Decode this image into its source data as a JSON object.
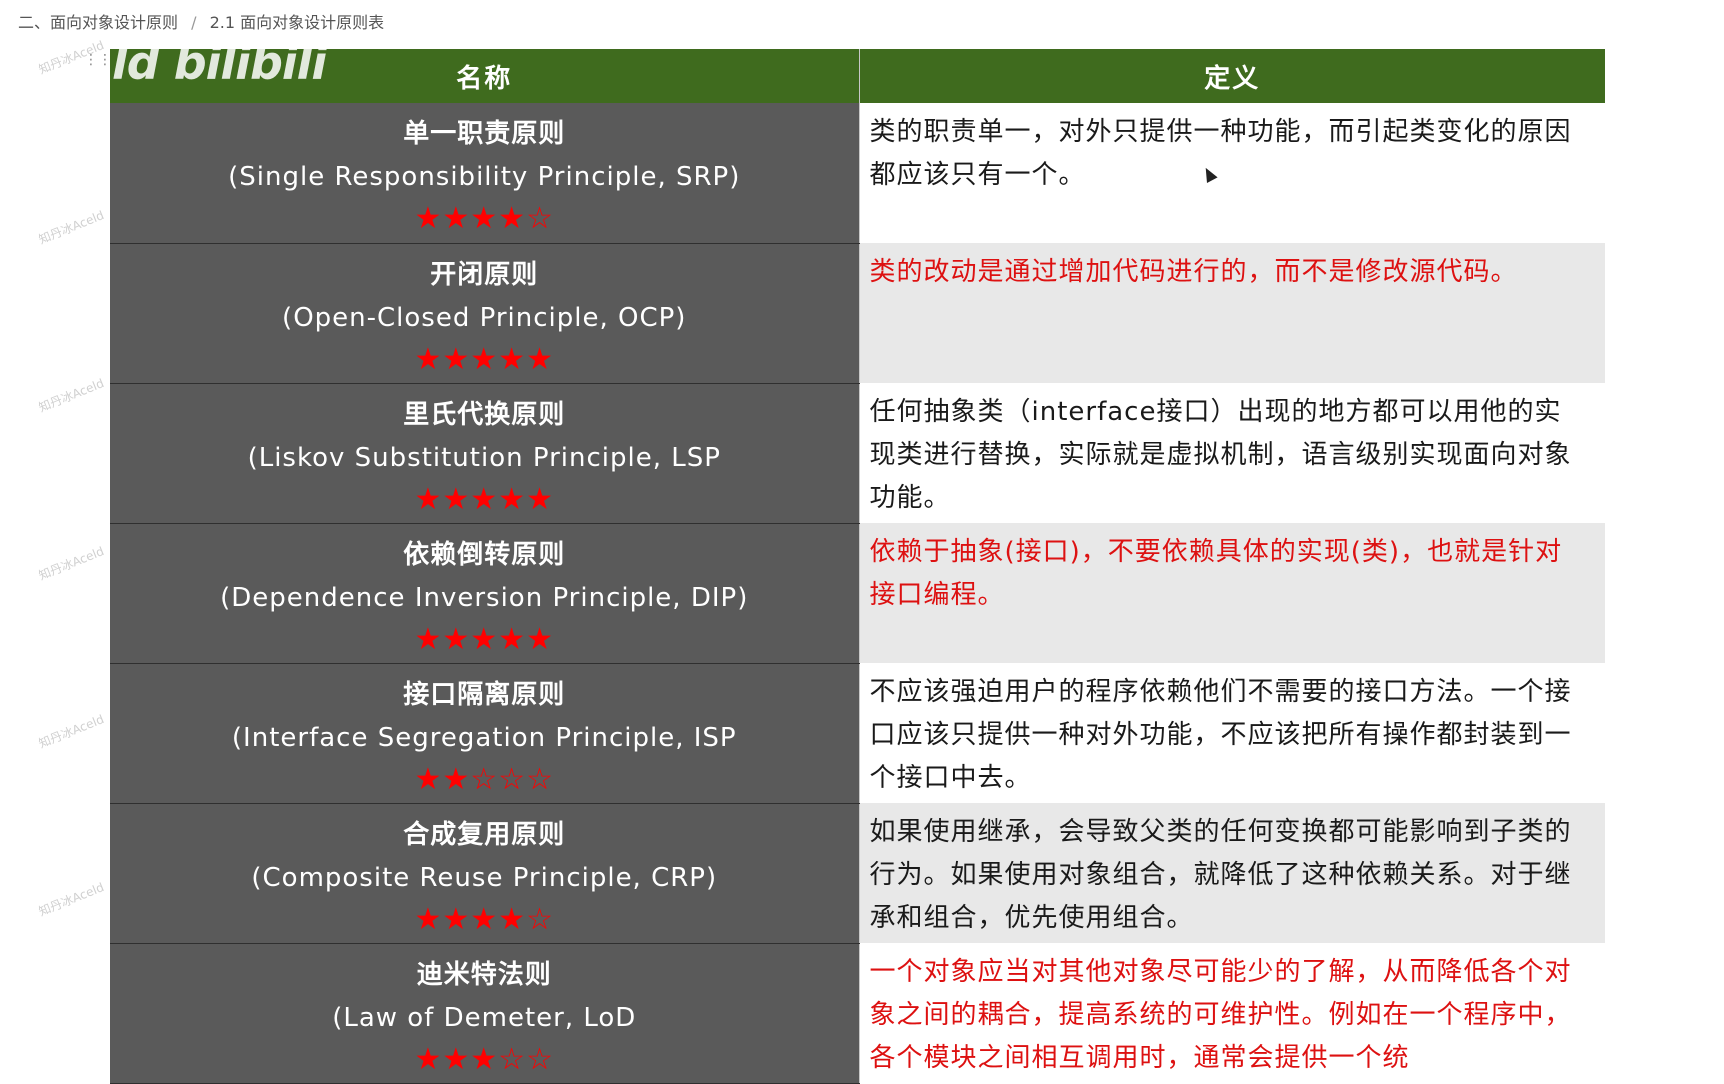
{
  "breadcrumb": {
    "section": "二、面向对象设计原则",
    "separator": "/",
    "page": "2.1 面向对象设计原则表"
  },
  "watermark": {
    "text": "知丹冰Aceld"
  },
  "logo": {
    "text": "ld bilibili"
  },
  "table": {
    "headers": {
      "name": "名称",
      "definition": "定义"
    },
    "rows": [
      {
        "name_cn": "单一职责原则",
        "name_en": "(Single Responsibility Principle, SRP)",
        "stars": "★★★★☆",
        "rating": 4,
        "definition": "类的职责单一，对外只提供一种功能，而引起类变化的原因都应该只有一个。",
        "highlight": false
      },
      {
        "name_cn": "开闭原则",
        "name_en": "(Open-Closed Principle, OCP)",
        "stars": "★★★★★",
        "rating": 5,
        "definition": "类的改动是通过增加代码进行的，而不是修改源代码。",
        "highlight": true
      },
      {
        "name_cn": "里氏代换原则",
        "name_en": "(Liskov Substitution Principle, LSP",
        "stars": "★★★★★",
        "rating": 5,
        "definition": "任何抽象类（interface接口）出现的地方都可以用他的实现类进行替换，实际就是虚拟机制，语言级别实现面向对象功能。",
        "highlight": false
      },
      {
        "name_cn": "依赖倒转原则",
        "name_en": "(Dependence  Inversion Principle, DIP)",
        "stars": "★★★★★",
        "rating": 5,
        "definition": "依赖于抽象(接口)，不要依赖具体的实现(类)，也就是针对接口编程。",
        "highlight": true
      },
      {
        "name_cn": "接口隔离原则",
        "name_en": "(Interface Segregation Principle, ISP",
        "stars": "★★☆☆☆",
        "rating": 2,
        "definition": "不应该强迫用户的程序依赖他们不需要的接口方法。一个接口应该只提供一种对外功能，不应该把所有操作都封装到一个接口中去。",
        "highlight": false
      },
      {
        "name_cn": "合成复用原则",
        "name_en": "(Composite Reuse Principle, CRP)",
        "stars": "★★★★☆",
        "rating": 4,
        "definition": "如果使用继承，会导致父类的任何变换都可能影响到子类的行为。如果使用对象组合，就降低了这种依赖关系。对于继承和组合，优先使用组合。",
        "highlight": false
      },
      {
        "name_cn": "迪米特法则",
        "name_en": "(Law of Demeter, LoD",
        "stars": "★★★☆☆",
        "rating": 3,
        "definition": "一个对象应当对其他对象尽可能少的了解，从而降低各个对象之间的耦合，提高系统的可维护性。例如在一个程序中，各个模块之间相互调用时，通常会提供一个统",
        "highlight": true
      }
    ]
  },
  "colors": {
    "header_bg": "#3f6b1e",
    "name_cell_bg": "#5a5a5a",
    "star_color": "#ff0000",
    "highlight_text": "#dd1111"
  }
}
